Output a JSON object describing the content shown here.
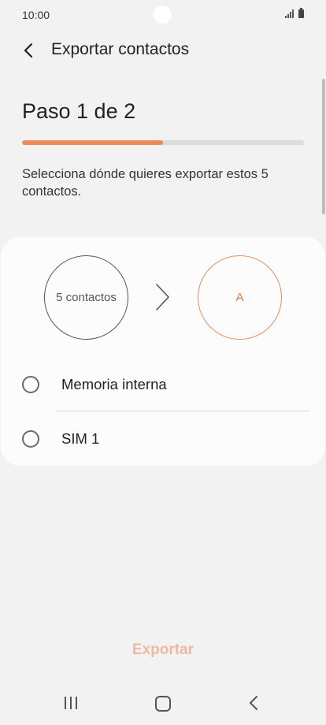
{
  "status_bar": {
    "time": "10:00"
  },
  "header": {
    "title": "Exportar contactos"
  },
  "step": {
    "title": "Paso 1 de 2",
    "progress": 0.5
  },
  "description": "Selecciona dónde quieres exportar estos 5 contactos.",
  "transfer": {
    "source_label": "5 contactos",
    "target_label": "A"
  },
  "options": [
    {
      "label": "Memoria interna",
      "selected": false
    },
    {
      "label": "SIM 1",
      "selected": false
    }
  ],
  "footer": {
    "export_label": "Exportar"
  },
  "colors": {
    "accent": "#ec8a5e",
    "disabled_accent": "#f0b89e"
  },
  "icons": [
    "back-arrow-icon",
    "chevron-right-icon",
    "signal-icon",
    "battery-icon",
    "recent-apps-icon",
    "home-icon",
    "nav-back-icon"
  ]
}
